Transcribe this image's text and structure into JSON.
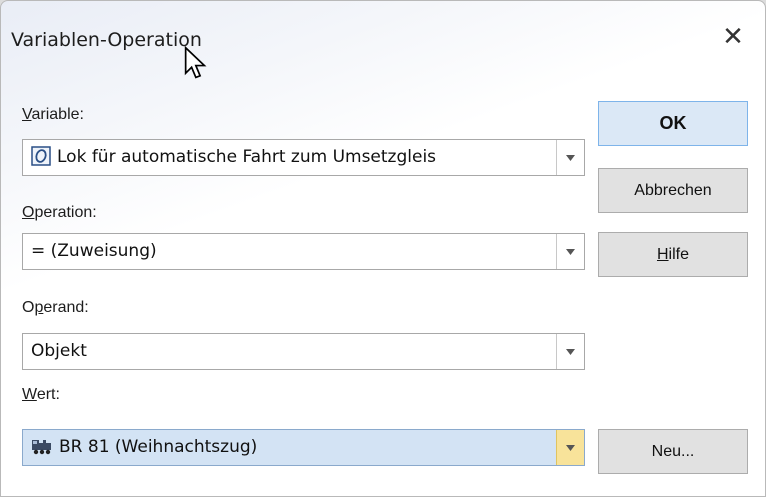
{
  "window": {
    "title": "Variablen-Operation"
  },
  "fields": {
    "variable": {
      "label_prefix": "",
      "label_mnemonic": "V",
      "label_rest": "ariable:",
      "value": "Lok für automatische Fahrt zum Umsetzgleis",
      "icon": "object-variable-icon"
    },
    "operation": {
      "label_mnemonic": "O",
      "label_rest": "peration:",
      "value": "= (Zuweisung)"
    },
    "operand": {
      "label_prefix": "O",
      "label_mnemonic": "p",
      "label_rest": "erand:",
      "value": "Objekt"
    },
    "wert": {
      "label_mnemonic": "W",
      "label_rest": "ert:",
      "value": "BR 81 (Weihnachtszug)",
      "icon": "locomotive-icon"
    }
  },
  "buttons": {
    "ok": "OK",
    "cancel": "Abbrechen",
    "help_mnemonic": "H",
    "help_rest": "ilfe",
    "new": "Neu..."
  },
  "colors": {
    "ok_border": "#7eb4ea",
    "selected_field": "#d3e3f4",
    "dropdown_highlight": "#f8e39a"
  }
}
